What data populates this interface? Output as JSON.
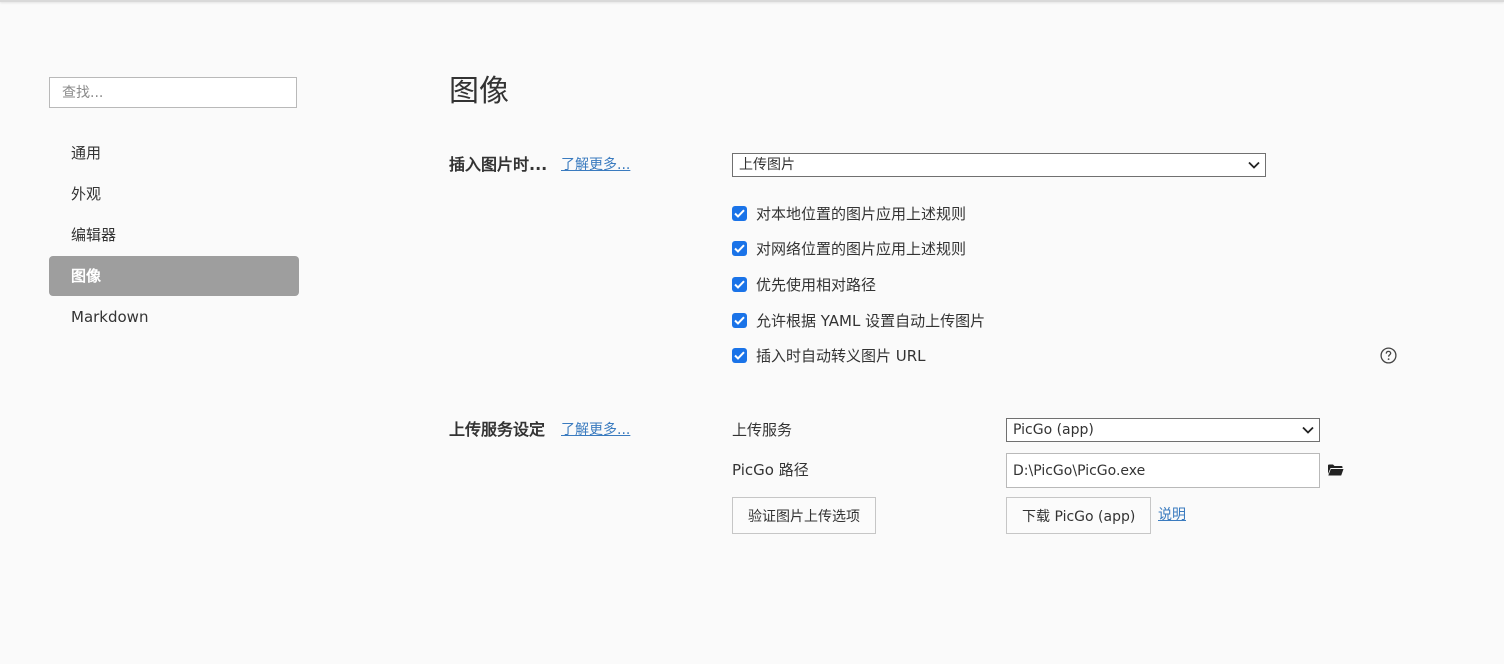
{
  "sidebar": {
    "search_placeholder": "查找...",
    "items": [
      {
        "label": "通用",
        "active": false
      },
      {
        "label": "外观",
        "active": false
      },
      {
        "label": "编辑器",
        "active": false
      },
      {
        "label": "图像",
        "active": true
      },
      {
        "label": "Markdown",
        "active": false
      }
    ]
  },
  "main": {
    "title": "图像",
    "insert_section": {
      "label": "插入图片时...",
      "learn_more": "了解更多...",
      "action_select": "上传图片",
      "options": [
        {
          "label": "对本地位置的图片应用上述规则",
          "checked": true
        },
        {
          "label": "对网络位置的图片应用上述规则",
          "checked": true
        },
        {
          "label": "优先使用相对路径",
          "checked": true
        },
        {
          "label": "允许根据 YAML 设置自动上传图片",
          "checked": true
        },
        {
          "label": "插入时自动转义图片 URL",
          "checked": true
        }
      ]
    },
    "upload_section": {
      "label": "上传服务设定",
      "learn_more": "了解更多...",
      "service_label": "上传服务",
      "service_value": "PicGo (app)",
      "path_label": "PicGo 路径",
      "path_value": "D:\\PicGo\\PicGo.exe",
      "verify_button": "验证图片上传选项",
      "download_button": "下载 PicGo (app)",
      "help_link": "说明"
    }
  },
  "icons": {
    "chevron": "chevron-down-icon",
    "check": "checkmark-icon",
    "help": "question-circle-icon",
    "folder": "folder-icon"
  },
  "colors": {
    "background": "#fafafa",
    "accent_checkbox": "#1a73e8",
    "link": "#3a7bbf",
    "active_nav": "#9e9e9e"
  }
}
